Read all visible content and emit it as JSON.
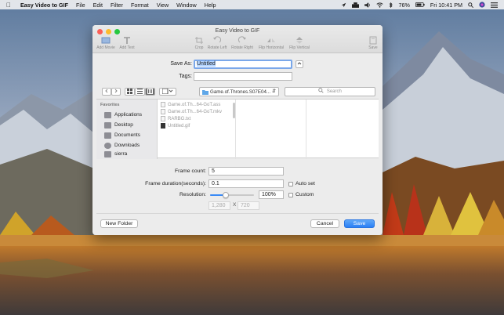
{
  "menubar": {
    "app_name": "Easy Video to GIF",
    "items": [
      "File",
      "Edit",
      "Filter",
      "Format",
      "View",
      "Window",
      "Help"
    ],
    "battery": "76%",
    "clock": "Fri 10:41 PM"
  },
  "window": {
    "title": "Easy Video to GIF",
    "toolbar": [
      {
        "label": "Add Movie",
        "icon": "film-icon"
      },
      {
        "label": "Add Text",
        "icon": "text-icon"
      },
      {
        "label": "Crop",
        "icon": "crop-icon"
      },
      {
        "label": "Rotate Left",
        "icon": "rotate-left-icon"
      },
      {
        "label": "Rotate Right",
        "icon": "rotate-right-icon"
      },
      {
        "label": "Flip Horizontal",
        "icon": "flip-horizontal-icon"
      },
      {
        "label": "Flip Vertical",
        "icon": "flip-vertical-icon"
      },
      {
        "label": "Save",
        "icon": "save-icon"
      }
    ]
  },
  "save_sheet": {
    "save_as_label": "Save As:",
    "save_as_value": "Untitled",
    "tags_label": "Tags:",
    "tags_value": "",
    "location": "Game.of.Thrones.S07E04...",
    "search_placeholder": "Search",
    "favorites_title": "Favorites",
    "favorites": [
      "Applications",
      "Desktop",
      "Documents",
      "Downloads",
      "sierra"
    ],
    "files": [
      "Game.of.Th...64-GoT.ass",
      "Game.of.Th...64-GoT.mkv",
      "RARBG.txt",
      "Untitled.gif"
    ]
  },
  "options": {
    "frame_count_label": "Frame count:",
    "frame_count": "5",
    "frame_duration_label": "Frame duration(seconds):",
    "frame_duration": "0.1",
    "auto_set_label": "Auto set",
    "resolution_label": "Resolution:",
    "resolution_percent": "100%",
    "resolution_level": 0.35,
    "custom_label": "Custom",
    "width_placeholder": "1,280",
    "x_label": "X",
    "height_placeholder": "720"
  },
  "buttons": {
    "new_folder": "New Folder",
    "cancel": "Cancel",
    "save": "Save"
  },
  "colors": {
    "accent": "#2a7ff5",
    "close": "#fc5f57",
    "minimize": "#fdbc2e",
    "maximize": "#27c840"
  }
}
